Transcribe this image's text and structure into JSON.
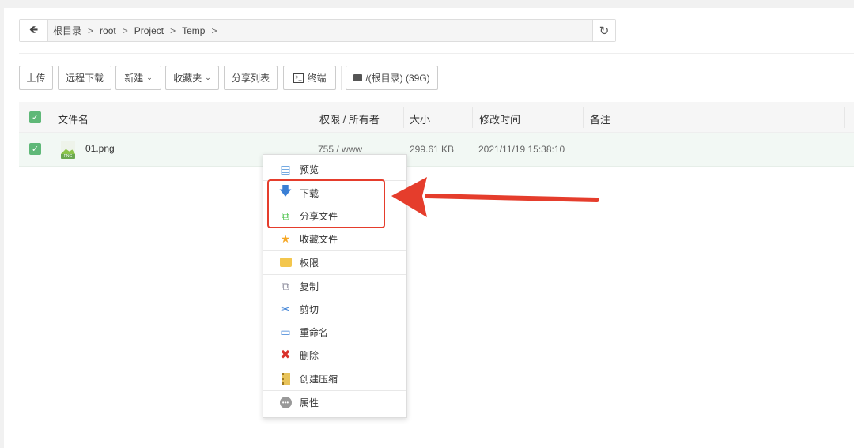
{
  "breadcrumb": {
    "items": [
      "根目录",
      "root",
      "Project",
      "Temp"
    ]
  },
  "toolbar": {
    "upload": "上传",
    "remote_download": "远程下载",
    "new": "新建",
    "favorites": "收藏夹",
    "share_list": "分享列表",
    "terminal": "终端",
    "disk": "/(根目录) (39G)"
  },
  "table": {
    "headers": {
      "name": "文件名",
      "perm": "权限 / 所有者",
      "size": "大小",
      "mtime": "修改时间",
      "note": "备注"
    },
    "rows": [
      {
        "name": "01.png",
        "perm": "755 / www",
        "size": "299.61 KB",
        "mtime": "2021/11/19 15:38:10",
        "note": "",
        "checked": true
      }
    ]
  },
  "context_menu": {
    "items": [
      "预览",
      "下载",
      "分享文件",
      "收藏文件",
      "权限",
      "复制",
      "剪切",
      "重命名",
      "删除",
      "创建压缩",
      "属性"
    ],
    "highlighted": [
      "下载",
      "分享文件"
    ]
  },
  "colors": {
    "accent": "#5fb878",
    "annotation": "#e53d2c"
  }
}
